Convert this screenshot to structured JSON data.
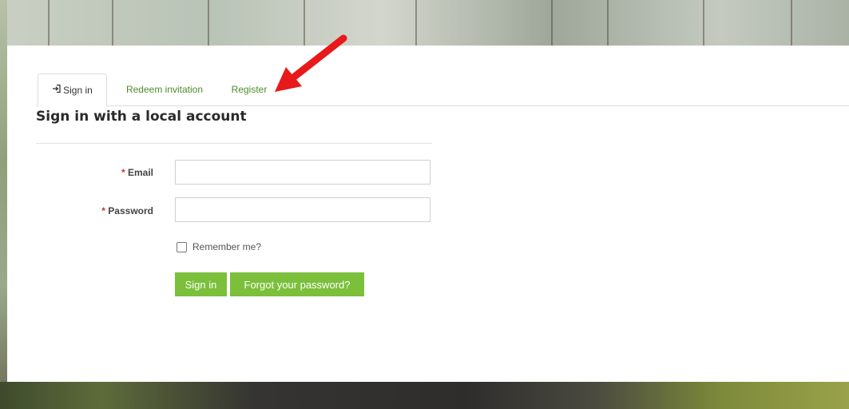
{
  "tabs": [
    {
      "label": "Sign in",
      "icon": "sign-in-icon",
      "active": true
    },
    {
      "label": "Redeem invitation",
      "active": false
    },
    {
      "label": "Register",
      "active": false
    }
  ],
  "form": {
    "heading": "Sign in with a local account",
    "email_required": "*",
    "email_label": "Email",
    "email_value": "",
    "password_required": "*",
    "password_label": "Password",
    "password_value": "",
    "remember_label": "Remember me?",
    "remember_checked": false,
    "signin_button": "Sign in",
    "forgot_button": "Forgot your password?"
  },
  "colors": {
    "accent": "#7bbf3b",
    "link": "#4e8b2b",
    "annotation_arrow": "#e8191b"
  }
}
